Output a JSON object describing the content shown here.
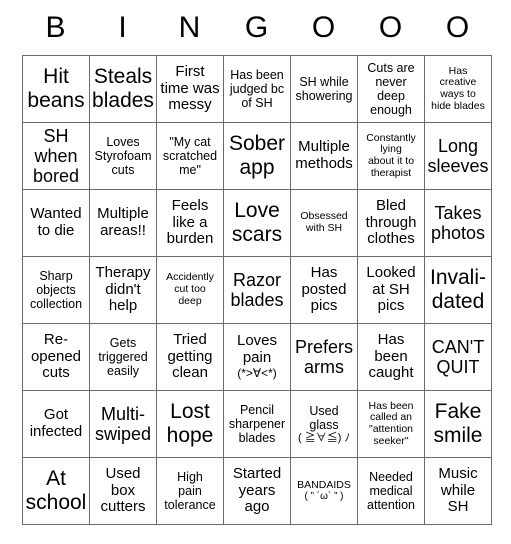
{
  "header": {
    "letters": [
      "B",
      "I",
      "N",
      "G",
      "O",
      "O",
      "O"
    ]
  },
  "grid": {
    "columns": 7,
    "rows": 7,
    "cells": [
      [
        {
          "text": "Hit\nbeans",
          "size": "xl"
        },
        {
          "text": "Steals\nblades",
          "size": "xl"
        },
        {
          "text": "First\ntime was\nmessy",
          "size": "m"
        },
        {
          "text": "Has been\njudged bc\nof SH",
          "size": "s"
        },
        {
          "text": "SH while\nshowering",
          "size": "s"
        },
        {
          "text": "Cuts are\nnever\ndeep\nenough",
          "size": "s"
        },
        {
          "text": "Has\ncreative\nways to\nhide blades",
          "size": "xs"
        }
      ],
      [
        {
          "text": "SH\nwhen\nbored",
          "size": "l"
        },
        {
          "text": "Loves\nStyrofoam\ncuts",
          "size": "s"
        },
        {
          "text": "\"My cat\nscratched\nme\"",
          "size": "s"
        },
        {
          "text": "Sober\napp",
          "size": "xl"
        },
        {
          "text": "Multiple\nmethods",
          "size": "m"
        },
        {
          "text": "Constantly\nlying\nabout it to\ntherapist",
          "size": "xs"
        },
        {
          "text": "Long\nsleeves",
          "size": "l"
        }
      ],
      [
        {
          "text": "Wanted\nto die",
          "size": "m"
        },
        {
          "text": "Multiple\nareas!!",
          "size": "m"
        },
        {
          "text": "Feels\nlike a\nburden",
          "size": "m"
        },
        {
          "text": "Love\nscars",
          "size": "xl"
        },
        {
          "text": "Obsessed\nwith SH",
          "size": "xs"
        },
        {
          "text": "Bled\nthrough\nclothes",
          "size": "m"
        },
        {
          "text": "Takes\nphotos",
          "size": "l"
        }
      ],
      [
        {
          "text": "Sharp\nobjects\ncollection",
          "size": "s"
        },
        {
          "text": "Therapy\ndidn't\nhelp",
          "size": "m"
        },
        {
          "text": "Accidently\ncut too\ndeep",
          "size": "xs"
        },
        {
          "text": "Razor\nblades",
          "size": "l"
        },
        {
          "text": "Has\nposted\npics",
          "size": "m"
        },
        {
          "text": "Looked\nat SH\npics",
          "size": "m"
        },
        {
          "text": "Invali-\ndated",
          "size": "xl"
        }
      ],
      [
        {
          "text": "Re-\nopened\ncuts",
          "size": "m"
        },
        {
          "text": "Gets\ntriggered\neasily",
          "size": "s"
        },
        {
          "text": "Tried\ngetting\nclean",
          "size": "m"
        },
        {
          "text": "Loves\npain",
          "size": "m",
          "kaomoji": "(*>∀<*)"
        },
        {
          "text": "Prefers\narms",
          "size": "l"
        },
        {
          "text": "Has\nbeen\ncaught",
          "size": "m"
        },
        {
          "text": "CAN'T\nQUIT",
          "size": "l"
        }
      ],
      [
        {
          "text": "Got\ninfected",
          "size": "m"
        },
        {
          "text": "Multi-\nswiped",
          "size": "l"
        },
        {
          "text": "Lost\nhope",
          "size": "xl"
        },
        {
          "text": "Pencil\nsharpener\nblades",
          "size": "s"
        },
        {
          "text": "Used\nglass",
          "size": "s",
          "kaomoji": "( ≧∀≦) ﾉ"
        },
        {
          "text": "Has been\ncalled an\n\"attention\nseeker\"",
          "size": "xs"
        },
        {
          "text": "Fake\nsmile",
          "size": "xl"
        }
      ],
      [
        {
          "text": "At\nschool",
          "size": "xl"
        },
        {
          "text": "Used\nbox\ncutters",
          "size": "m"
        },
        {
          "text": "High\npain\ntolerance",
          "size": "s"
        },
        {
          "text": "Started\nyears\nago",
          "size": "m"
        },
        {
          "text": "BANDAIDS",
          "size": "xs",
          "kaomoji": "( ” ´ω` ” )"
        },
        {
          "text": "Needed\nmedical\nattention",
          "size": "s"
        },
        {
          "text": "Music\nwhile\nSH",
          "size": "m"
        }
      ]
    ]
  },
  "colors": {
    "background": "#ffffff",
    "text": "#000000",
    "border": "#6b6b6b"
  }
}
